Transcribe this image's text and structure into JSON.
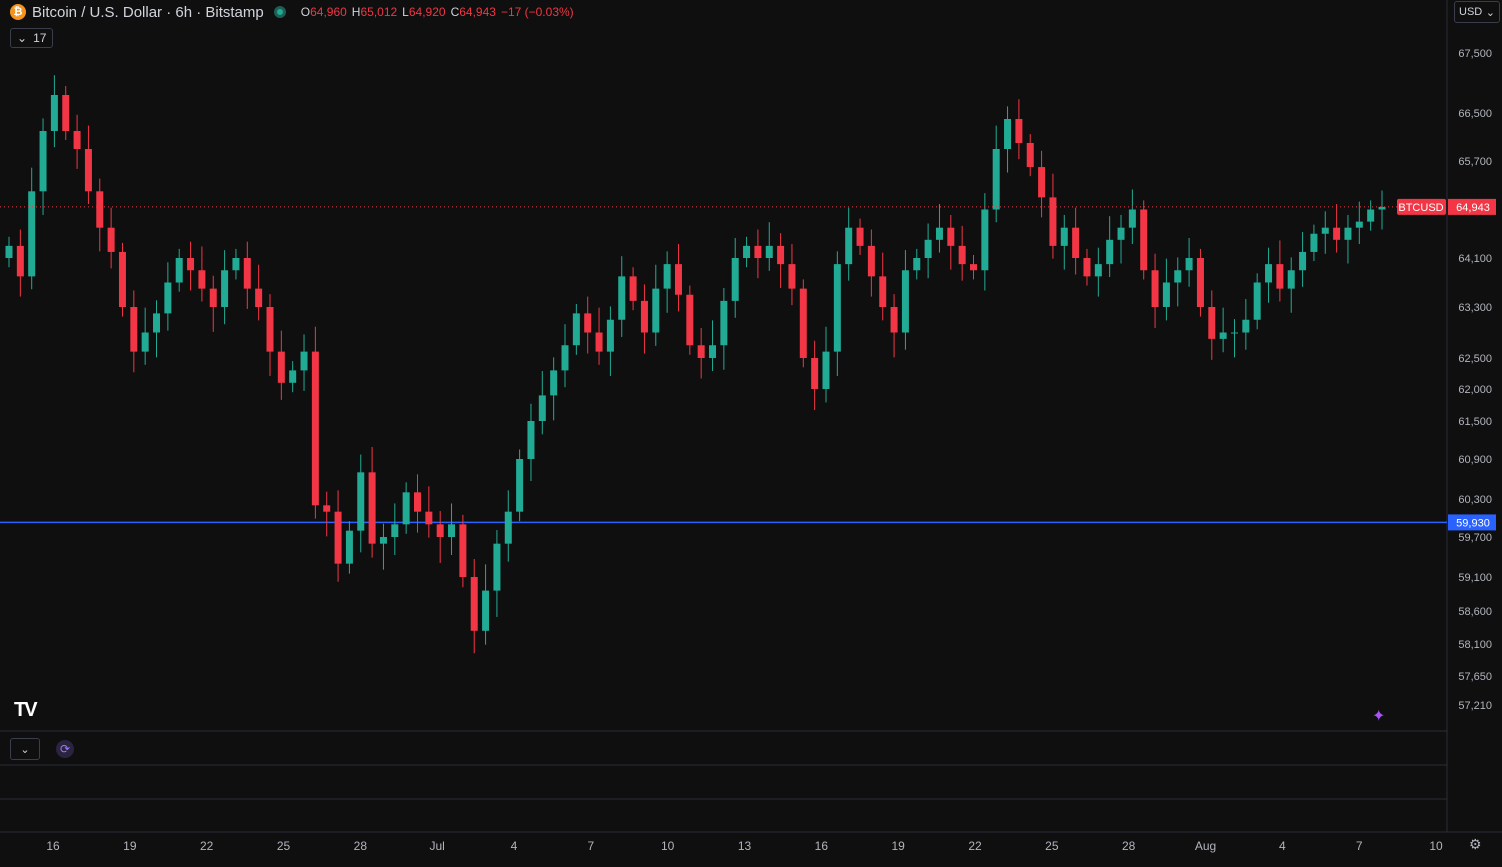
{
  "header": {
    "symbol_title": "Bitcoin / U.S. Dollar · 6h · Bitstamp",
    "ohlc": {
      "o_label": "O",
      "o_value": "64,960",
      "h_label": "H",
      "h_value": "65,012",
      "l_label": "L",
      "l_value": "64,920",
      "c_label": "C",
      "c_value": "64,943",
      "change": "−17 (−0.03%)"
    },
    "indicators_count": "17",
    "currency": "USD"
  },
  "icons": {
    "coin": "bitcoin-icon",
    "market_status": "market-open-dot-icon",
    "logo": "tradingview-logo",
    "collapse": "chevron-down-icon",
    "replay": "replay-icon",
    "assistant": "sparkle-icon",
    "settings": "gear-icon"
  },
  "colors": {
    "up": "#22ab94",
    "down": "#f23645",
    "horizontal_line": "#2962ff",
    "background": "#0f0f0f"
  },
  "price_scale": {
    "ticks": [
      "67,500",
      "66,500",
      "65,700",
      "64,100",
      "63,300",
      "62,500",
      "62,000",
      "61,500",
      "60,900",
      "60,300",
      "59,700",
      "59,100",
      "58,600",
      "58,100",
      "57,650",
      "57,210"
    ],
    "last_price_symbol": "BTCUSD",
    "last_price": "64,943",
    "hline_price": "59,930"
  },
  "time_scale": {
    "ticks": [
      "16",
      "19",
      "22",
      "25",
      "28",
      "Jul",
      "4",
      "7",
      "10",
      "13",
      "16",
      "19",
      "22",
      "25",
      "28",
      "Aug",
      "4",
      "7",
      "10"
    ]
  },
  "chart_data": {
    "type": "candlestick",
    "title": "Bitcoin / U.S. Dollar · 6h · Bitstamp",
    "xlabel": "",
    "ylabel": "",
    "ylim": [
      57000,
      68000
    ],
    "last_price": 64943,
    "horizontal_line": 59930,
    "close_series": [
      64300,
      63800,
      65200,
      66200,
      66800,
      66200,
      65900,
      65200,
      64600,
      64200,
      63300,
      62600,
      62900,
      63200,
      63700,
      64100,
      63900,
      63600,
      63300,
      63900,
      64100,
      63600,
      63300,
      62600,
      62100,
      62300,
      62600,
      60200,
      60100,
      59300,
      59800,
      60700,
      59600,
      59700,
      59900,
      60400,
      60100,
      59900,
      59700,
      59900,
      59100,
      58300,
      58900,
      59600,
      60100,
      60900,
      61500,
      61900,
      62300,
      62700,
      63200,
      62900,
      62600,
      63100,
      63800,
      63400,
      62900,
      63600,
      64000,
      63500,
      62700,
      62500,
      62700,
      63400,
      64100,
      64300,
      64100,
      64300,
      64000,
      63600,
      62500,
      62000,
      62600,
      64000,
      64600,
      64300,
      63800,
      63300,
      62900,
      63900,
      64100,
      64400,
      64600,
      64300,
      64000,
      63900,
      64900,
      65900,
      66400,
      66000,
      65600,
      65100,
      64300,
      64600,
      64100,
      63800,
      64000,
      64400,
      64600,
      64900,
      63900,
      63300,
      63700,
      63900,
      64100,
      63300,
      62800,
      62900,
      62900,
      63100,
      63700,
      64000,
      63600,
      63900,
      64200,
      64500,
      64600,
      64400,
      64600,
      64700,
      64900,
      64943
    ]
  }
}
